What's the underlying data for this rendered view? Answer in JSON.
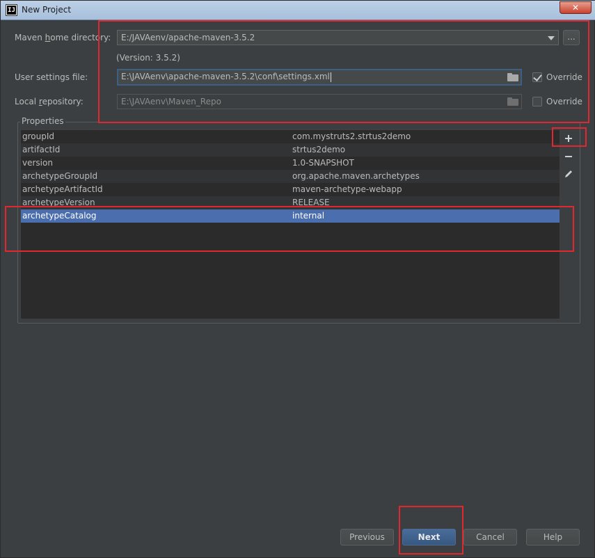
{
  "window": {
    "title": "New Project",
    "close_label": "✕"
  },
  "maven_home": {
    "label_pre": "Maven ",
    "label_mnemonic": "h",
    "label_post": "ome directory:",
    "value": "E:/JAVAenv/apache-maven-3.5.2",
    "browse_label": "...",
    "version": "(Version: 3.5.2)"
  },
  "user_settings": {
    "label": "User settings file:",
    "value": "E:\\JAVAenv\\apache-maven-3.5.2\\conf\\settings.xml",
    "override_label": "Override",
    "override_checked": true
  },
  "local_repo": {
    "label_pre": "Local ",
    "label_mnemonic": "r",
    "label_post": "epository:",
    "value": "E:\\JAVAenv\\Maven_Repo",
    "override_label": "Override",
    "override_checked": false
  },
  "properties": {
    "title": "Properties",
    "rows": [
      {
        "key": "groupId",
        "value": "com.mystruts2.strtus2demo"
      },
      {
        "key": "artifactId",
        "value": "strtus2demo"
      },
      {
        "key": "version",
        "value": "1.0-SNAPSHOT"
      },
      {
        "key": "archetypeGroupId",
        "value": "org.apache.maven.archetypes"
      },
      {
        "key": "archetypeArtifactId",
        "value": "maven-archetype-webapp"
      },
      {
        "key": "archetypeVersion",
        "value": "RELEASE"
      },
      {
        "key": "archetypeCatalog",
        "value": "internal"
      }
    ],
    "selected_row": 6
  },
  "buttons": {
    "previous": "Previous",
    "next": "Next",
    "cancel": "Cancel",
    "help": "Help"
  },
  "colors": {
    "annotation": "#e0282e",
    "selection": "#4b6eaf",
    "background": "#3c3f41"
  }
}
